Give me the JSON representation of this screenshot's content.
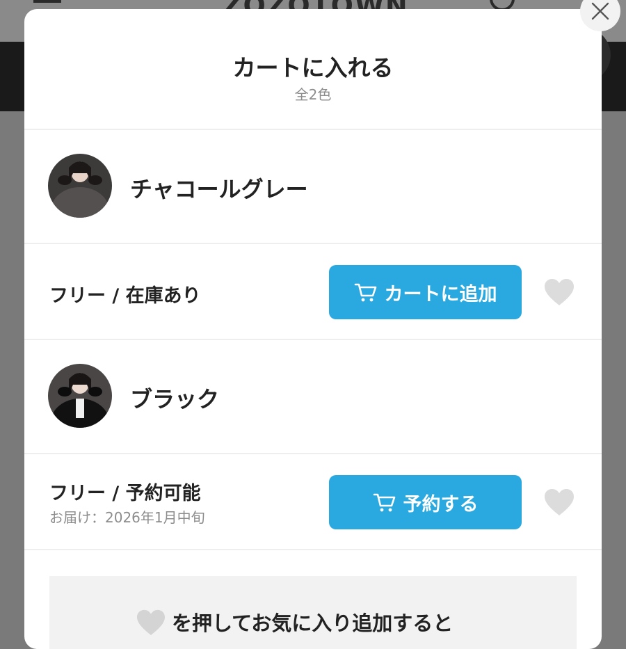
{
  "background": {
    "logo_text": "ZOZOTOWN"
  },
  "modal": {
    "title": "カートに入れる",
    "subtitle": "全2色",
    "colors": [
      {
        "name": "チャコールグレー",
        "size_label": "フリー / 在庫あり",
        "delivery_note": "",
        "button_label": "カートに追加"
      },
      {
        "name": "ブラック",
        "size_label": "フリー / 予約可能",
        "delivery_note": "お届け：2026年1月中旬",
        "button_label": "予約する"
      }
    ],
    "info_text": "を押してお気に入り追加すると"
  },
  "colors": {
    "accent": "#29a9e0",
    "heart": "#dcdcdc"
  },
  "icons": {
    "close": "close-icon",
    "cart": "cart-icon",
    "heart": "heart-icon"
  }
}
